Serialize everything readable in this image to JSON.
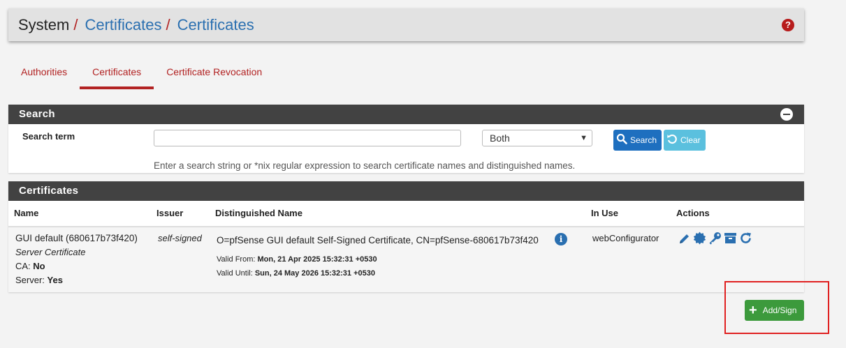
{
  "breadcrumb": {
    "root": "System",
    "sep1": "/",
    "section": "Certificates",
    "sep2": "/",
    "page": "Certificates"
  },
  "help_icon": "question-circle-icon",
  "tabs": [
    {
      "label": "Authorities",
      "active": false
    },
    {
      "label": "Certificates",
      "active": true
    },
    {
      "label": "Certificate Revocation",
      "active": false
    }
  ],
  "search_panel": {
    "title": "Search",
    "term_label": "Search term",
    "term_value": "",
    "scope_selected": "Both",
    "search_button": "Search",
    "clear_button": "Clear",
    "help_text": "Enter a search string or *nix regular expression to search certificate names and distinguished names."
  },
  "certs_panel": {
    "title": "Certificates",
    "columns": [
      "Name",
      "Issuer",
      "Distinguished Name",
      "In Use",
      "Actions"
    ],
    "rows": [
      {
        "name": "GUI default (680617b73f420)",
        "type": "Server Certificate",
        "ca_label": "CA:",
        "ca_value": "No",
        "server_label": "Server:",
        "server_value": "Yes",
        "issuer": "self-signed",
        "dn": "O=pfSense GUI default Self-Signed Certificate, CN=pfSense-680617b73f420",
        "valid_from_label": "Valid From:",
        "valid_from": "Mon, 21 Apr 2025 15:32:31 +0530",
        "valid_until_label": "Valid Until:",
        "valid_until": "Sun, 24 May 2026 15:32:31 +0530",
        "in_use": "webConfigurator"
      }
    ]
  },
  "add_button": "Add/Sign",
  "colors": {
    "accent_red": "#b22222",
    "link_blue": "#2a6fb0",
    "panel_head": "#424242",
    "add_green": "#3c9a3c"
  }
}
